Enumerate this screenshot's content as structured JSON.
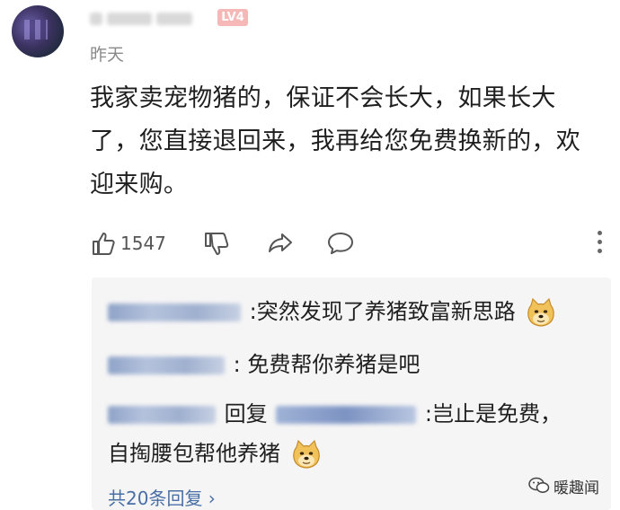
{
  "post": {
    "user_level": "LV4",
    "date": "昨天",
    "comment": "我家卖宠物猪的，保证不会长大，如果长大了，您直接退回来，我再给您免费换新的，欢迎来购。",
    "like_count": "1547"
  },
  "replies": [
    {
      "text": ":突然发现了养猪致富新思路",
      "emoji": "doge-emoji"
    },
    {
      "text": ": 免费帮你养猪是吧"
    },
    {
      "reply_word": "回复",
      "text_line1": ":岂止是免费，",
      "text_line2": "自掏腰包帮他养猪",
      "emoji": "doge-emoji"
    }
  ],
  "more_replies": "共20条回复 ›",
  "watermark": "暖趣闻",
  "icons": [
    "like-icon",
    "dislike-icon",
    "share-icon",
    "comment-icon",
    "more-icon",
    "doge-emoji",
    "wechat-icon"
  ],
  "colors": {
    "link": "#4a6fa5",
    "reply_bg": "#f5f5f5",
    "level_badge": "#f6b7b7"
  }
}
